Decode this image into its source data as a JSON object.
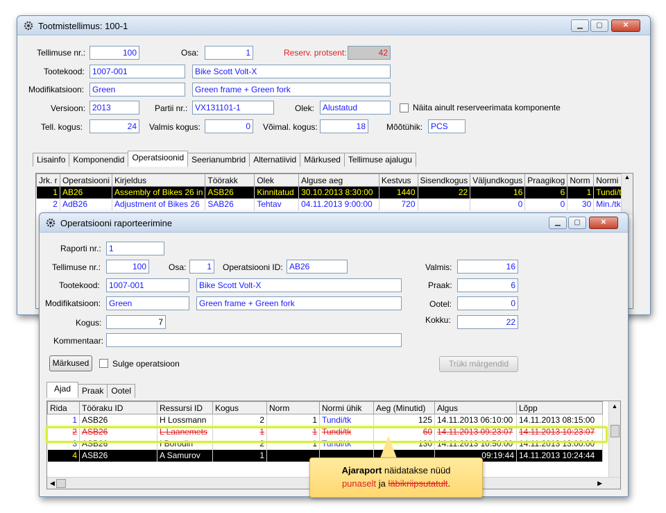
{
  "main_window": {
    "title": "Tootmistellimus: 100-1",
    "fields": {
      "tellimuse_nr_label": "Tellimuse nr.:",
      "tellimuse_nr": "100",
      "osa_label": "Osa:",
      "osa": "1",
      "reserv_label": "Reserv. protsent:",
      "reserv": "42",
      "tootekood_label": "Tootekood:",
      "tootekood": "1007-001",
      "tootekood_desc": "Bike Scott Volt-X",
      "modifikatsioon_label": "Modifikatsioon:",
      "modifikatsioon": "Green",
      "modifikatsioon_desc": "Green frame + Green fork",
      "versioon_label": "Versioon:",
      "versioon": "2013",
      "partii_label": "Partii nr.:",
      "partii": "VX131101-1",
      "olek_label": "Olek:",
      "olek": "Alustatud",
      "naita_label": "Näita ainult reserveerimata komponente",
      "tell_kogus_label": "Tell. kogus:",
      "tell_kogus": "24",
      "valmis_kogus_label": "Valmis kogus:",
      "valmis_kogus": "0",
      "voimal_kogus_label": "Võimal. kogus:",
      "voimal_kogus": "18",
      "mootuhik_label": "Mõõtühik:",
      "mootuhik": "PCS"
    },
    "tabs": [
      "Lisainfo",
      "Komponendid",
      "Operatsioonid",
      "Seerianumbrid",
      "Alternatiivid",
      "Märkused",
      "Tellimuse ajalugu"
    ],
    "ops_columns": [
      "Jrk. r",
      "Operatsiooni",
      "Kirjeldus",
      "Töörakk",
      "Olek",
      "Alguse aeg",
      "Kestvus",
      "Sisendkogus",
      "Väljundkogus",
      "Praagikog",
      "Norm",
      "Normi üh"
    ],
    "ops_rows": [
      [
        "1",
        "AB26",
        "Assembly of Bikes 26 in",
        "ASB26",
        "Kinnitatud",
        "30.10.2013 8:30:00",
        "1440",
        "22",
        "16",
        "6",
        "1",
        "Tundi/tk"
      ],
      [
        "2",
        "AdB26",
        "Adjustment of Bikes 26",
        "SAB26",
        "Tehtav",
        "04.11.2013 9:00:00",
        "720",
        "",
        "0",
        "0",
        "30",
        "Min./tk"
      ]
    ]
  },
  "report_window": {
    "title": "Operatsiooni raporteerimine",
    "fields": {
      "raporti_nr_label": "Raporti nr.:",
      "raporti_nr": "1",
      "tellimuse_nr_label": "Tellimuse nr.:",
      "tellimuse_nr": "100",
      "osa_label": "Osa:",
      "osa": "1",
      "op_id_label": "Operatsiooni ID:",
      "op_id": "AB26",
      "tootekood_label": "Tootekood:",
      "tootekood": "1007-001",
      "tootekood_desc": "Bike Scott Volt-X",
      "modifikatsioon_label": "Modifikatsioon:",
      "modifikatsioon": "Green",
      "modifikatsioon_desc": "Green frame + Green fork",
      "kogus_label": "Kogus:",
      "kogus": "7",
      "kommentaar_label": "Kommentaar:",
      "kommentaar": "",
      "valmis_label": "Valmis:",
      "valmis": "16",
      "praak_label": "Praak:",
      "praak": "6",
      "ootel_label": "Ootel:",
      "ootel": "0",
      "kokku_label": "Kokku:",
      "kokku": "22"
    },
    "markused_button": "Märkused",
    "sulge_label": "Sulge operatsioon",
    "truki_button": "Trüki märgendid",
    "tabs": [
      "Ajad",
      "Praak",
      "Ootel"
    ],
    "time_columns": [
      "Rida",
      "Tööraku ID",
      "Ressursi ID",
      "Kogus",
      "Norm",
      "Normi ühik",
      "Aeg (Minutid)",
      "Algus",
      "Lõpp"
    ],
    "time_rows": [
      [
        "1",
        "ASB26",
        "H Lossmann",
        "2",
        "1",
        "Tundi/tk",
        "125",
        "14.11.2013 06:10:00",
        "14.11.2013 08:15:00"
      ],
      [
        "2",
        "ASB26",
        "L Laanemets",
        "1",
        "1",
        "Tundi/tk",
        "60",
        "14.11.2013 09:23:07",
        "14.11.2013 10:23:07"
      ],
      [
        "3",
        "ASB26",
        "I Borodin",
        "2",
        "1",
        "Tundi/tk",
        "130",
        "14.11.2013 10:50:00",
        "14.11.2013 13:00:00"
      ],
      [
        "4",
        "ASB26",
        "A Samurov",
        "1",
        "",
        "",
        "",
        "09:19:44",
        "14.11.2013 10:24:44"
      ]
    ]
  },
  "callout": {
    "bold": "Ajaraport",
    "text1": " näidatakse nüüd",
    "red": "punaselt",
    "text2": " ja ",
    "strike": "läbikriipsutatult",
    "end": "."
  },
  "colors": {
    "highlight_yellow": "#ffff00",
    "field_blue": "#1a1aff",
    "strike_red": "#e02020"
  }
}
